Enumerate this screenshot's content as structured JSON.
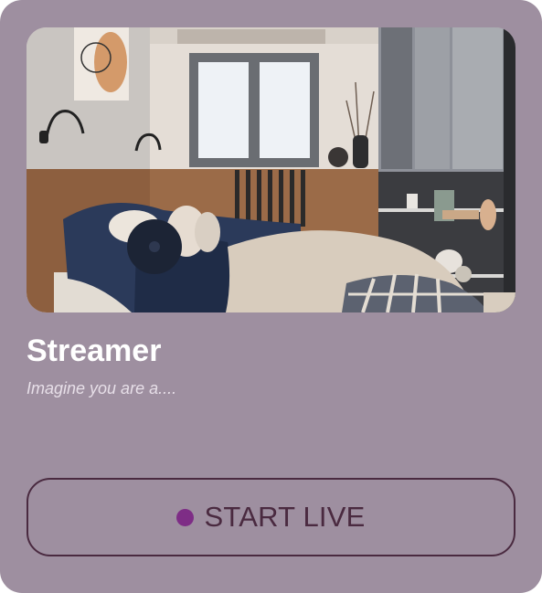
{
  "card": {
    "title": "Streamer",
    "subtitle": "Imagine you are a....",
    "image_icon": "bedroom-photo"
  },
  "action": {
    "label": "START LIVE",
    "dot_color": "#7e2d86"
  },
  "colors": {
    "card_background": "#9e8fa0",
    "button_border": "#4a2a40",
    "title_text": "#ffffff"
  }
}
